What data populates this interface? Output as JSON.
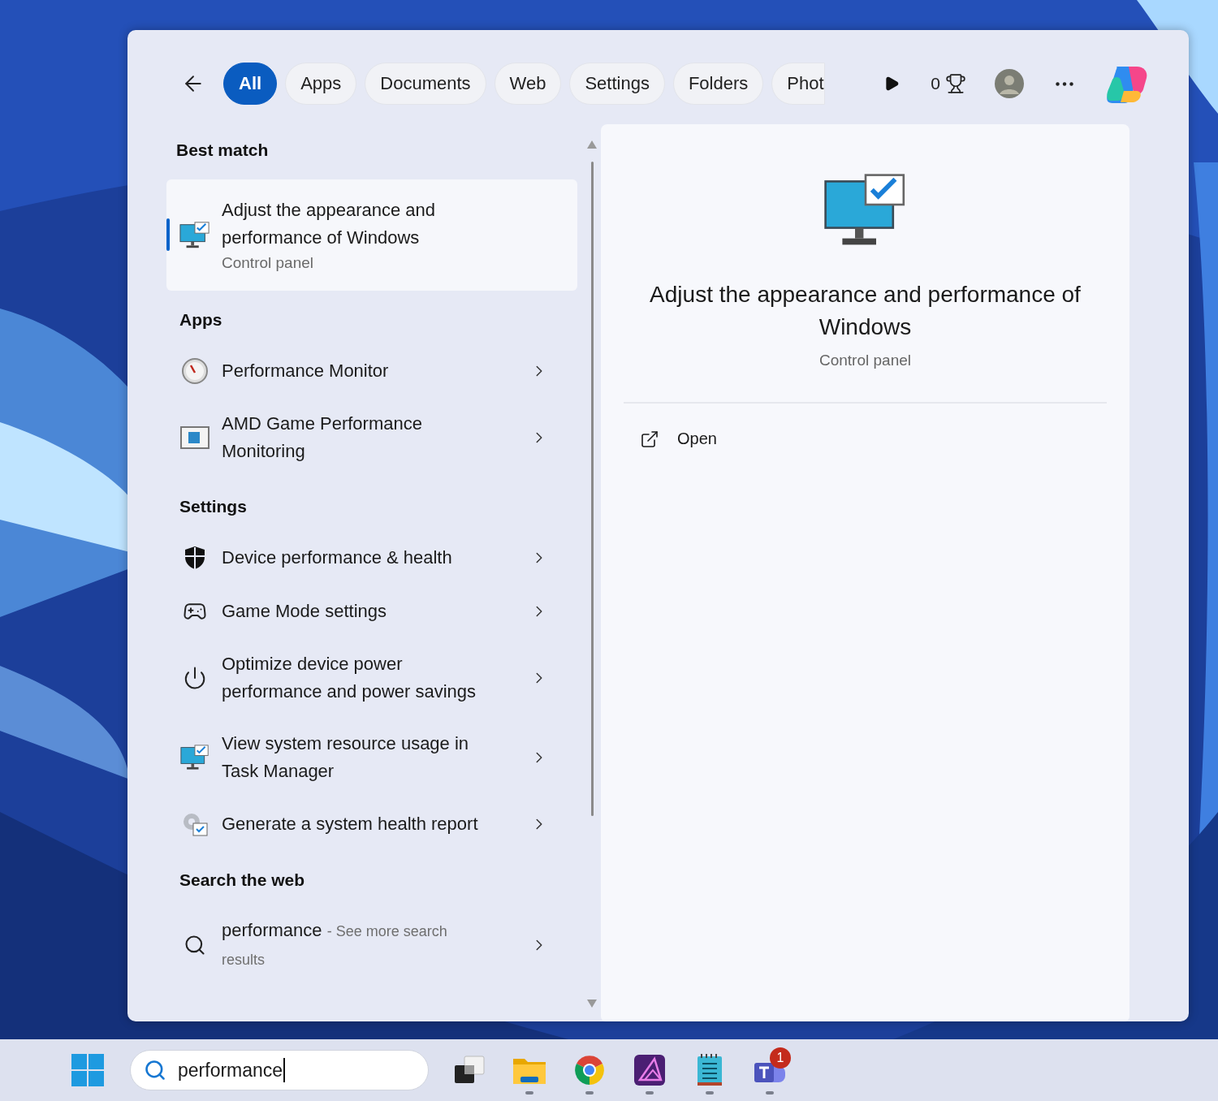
{
  "search_panel": {
    "filter_tabs": [
      {
        "label": "All",
        "selected": true
      },
      {
        "label": "Apps",
        "selected": false
      },
      {
        "label": "Documents",
        "selected": false
      },
      {
        "label": "Web",
        "selected": false
      },
      {
        "label": "Settings",
        "selected": false
      },
      {
        "label": "Folders",
        "selected": false
      },
      {
        "label": "Phot",
        "selected": false
      }
    ],
    "rewards_count": "0",
    "results": [
      {
        "heading": "Best match",
        "items": [
          {
            "kind": "best",
            "title": "Adjust the appearance and performance of Windows",
            "subtitle": "Control panel",
            "selected": true
          }
        ]
      },
      {
        "heading": "Apps",
        "items": [
          {
            "kind": "item",
            "title": "Performance Monitor",
            "selected": false
          },
          {
            "kind": "item",
            "title": "AMD Game Performance Monitoring",
            "selected": false
          }
        ]
      },
      {
        "heading": "Settings",
        "items": [
          {
            "kind": "item",
            "title": "Device performance & health",
            "selected": false
          },
          {
            "kind": "item",
            "title": "Game Mode settings",
            "selected": false
          },
          {
            "kind": "item",
            "title": "Optimize device power performance and power savings",
            "selected": false
          },
          {
            "kind": "item",
            "title": "View system resource usage in Task Manager",
            "selected": false
          },
          {
            "kind": "item",
            "title": "Generate a system health report",
            "selected": false
          }
        ]
      },
      {
        "heading": "Search the web",
        "items": [
          {
            "kind": "web",
            "title": "performance",
            "hint": "- See more search results",
            "selected": false
          }
        ]
      }
    ],
    "preview": {
      "title": "Adjust the appearance and performance of Windows",
      "subtitle": "Control panel",
      "actions": [
        {
          "label": "Open"
        }
      ]
    }
  },
  "taskbar": {
    "search": {
      "value": "performance"
    },
    "apps": [
      {
        "running": false
      },
      {
        "running": true
      },
      {
        "running": true
      },
      {
        "running": true
      },
      {
        "running": true
      },
      {
        "running": true,
        "badge": "1"
      }
    ]
  }
}
